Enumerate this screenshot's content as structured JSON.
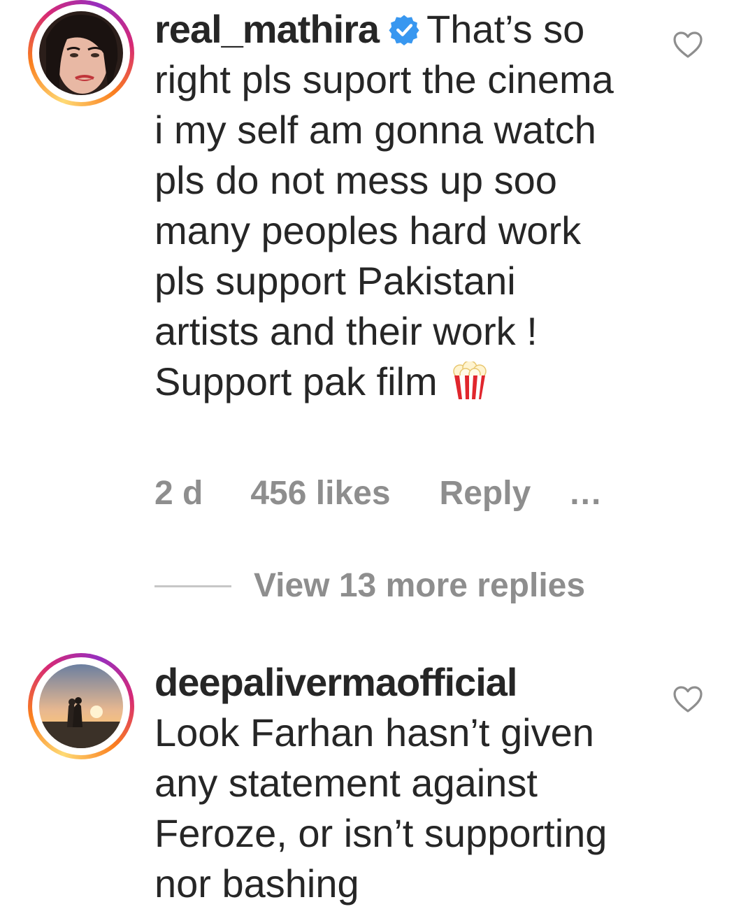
{
  "comments": [
    {
      "username": "real_mathira",
      "verified": true,
      "text": "That’s so right pls suport the cinema i my self am gonna watch pls do not mess up soo many peoples hard work pls support Pakistani artists and their work ! Support pak film",
      "emoji": "popcorn-icon",
      "time": "2 d",
      "likes": "456 likes",
      "reply_label": "Reply",
      "more_label": "...",
      "view_replies_label": "View 13 more replies"
    },
    {
      "username": "deepalivermaofficial",
      "verified": false,
      "text": "Look Farhan hasn’t given any statement against Feroze, or isn’t supporting nor bashing"
    }
  ],
  "colors": {
    "text": "#262626",
    "secondary": "#8e8e8e",
    "verified": "#3897f0",
    "divider": "#c7c7c7"
  }
}
